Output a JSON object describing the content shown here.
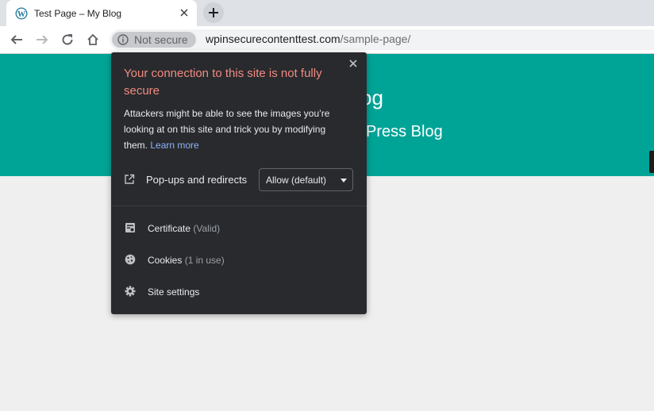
{
  "browser": {
    "tab": {
      "title": "Test Page – My Blog"
    },
    "address": {
      "security_chip": "Not secure",
      "host": "wpinsecurecontenttest.com",
      "path": "/sample-page/"
    }
  },
  "page": {
    "site_title": "og",
    "site_tagline": "Press Blog",
    "hero_color": "#00a497"
  },
  "popup": {
    "title": "Your connection to this site is not fully secure",
    "description": "Attackers might be able to see the images you’re looking at on this site and trick you by modifying them.",
    "learn_more": "Learn more",
    "permission": {
      "label": "Pop-ups and redirects",
      "value": "Allow (default)"
    },
    "items": [
      {
        "label": "Certificate",
        "detail": "(Valid)",
        "icon": "certificate-icon"
      },
      {
        "label": "Cookies",
        "detail": "(1 in use)",
        "icon": "cookie-icon"
      },
      {
        "label": "Site settings",
        "detail": "",
        "icon": "gear-icon"
      }
    ],
    "warning_color": "#f28b82",
    "link_color": "#8ab4f8"
  }
}
